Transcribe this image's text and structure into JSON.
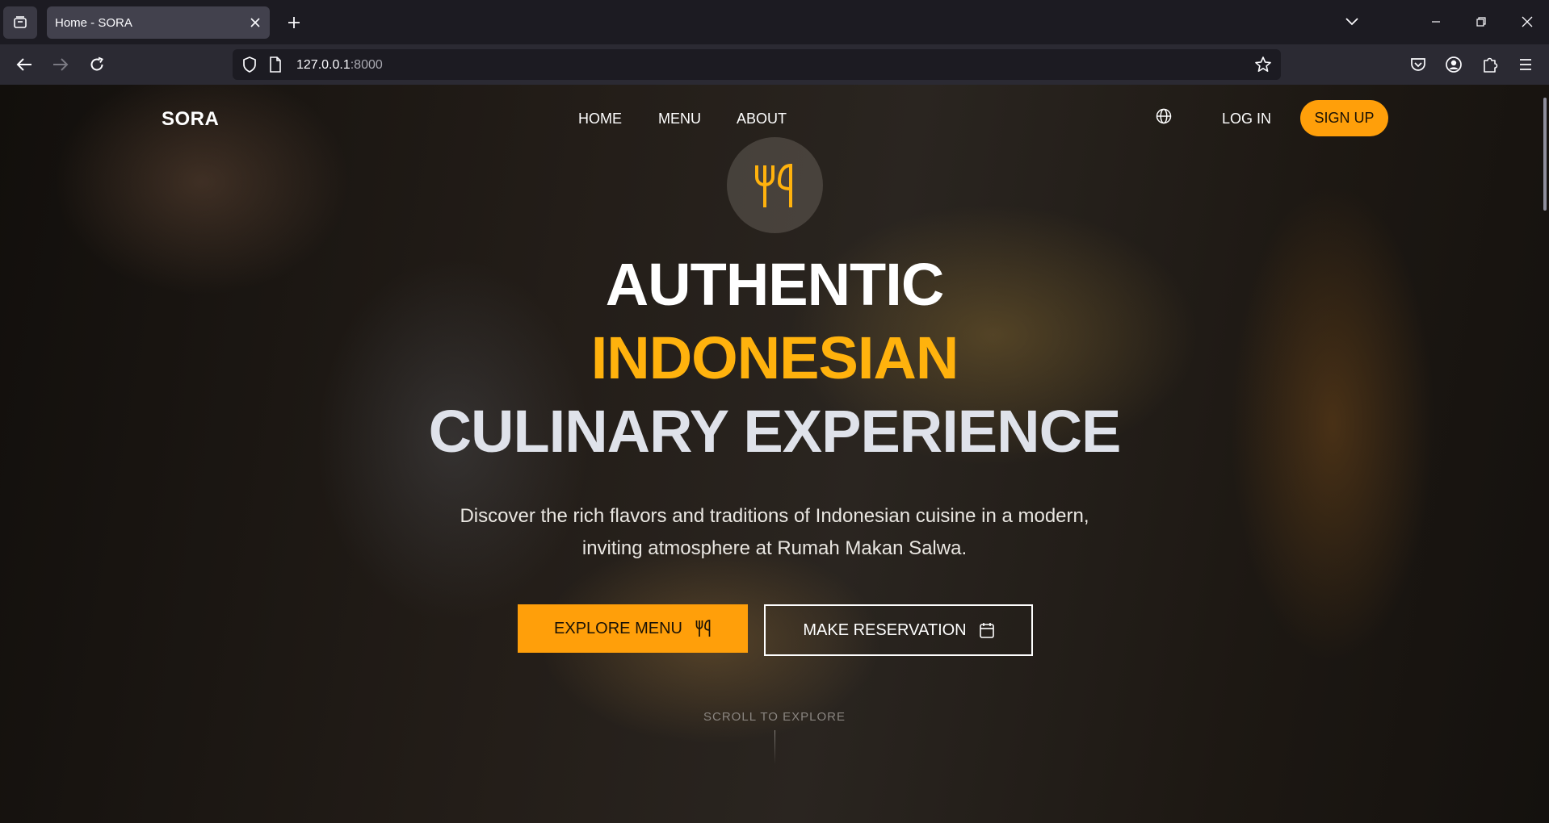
{
  "browser": {
    "tab_title": "Home - SORA",
    "url_host": "127.0.0.1",
    "url_port": ":8000",
    "icons": [
      "tab-list-icon",
      "close-icon",
      "plus-icon",
      "chevron-down-icon",
      "minimize-icon",
      "restore-icon",
      "close-window-icon",
      "back-arrow-icon",
      "forward-arrow-icon",
      "reload-icon",
      "shield-icon",
      "page-icon",
      "star-icon",
      "pocket-icon",
      "account-icon",
      "extensions-icon",
      "menu-icon"
    ]
  },
  "site": {
    "brand": "SORA",
    "nav": {
      "home": "HOME",
      "menu": "MENU",
      "about": "ABOUT"
    },
    "login": "LOG IN",
    "signup": "SIGN UP",
    "accent_color": "#ff9f0a"
  },
  "hero": {
    "line1": "AUTHENTIC",
    "line2": "INDONESIAN",
    "line3": "CULINARY EXPERIENCE",
    "subtitle_line1": "Discover the rich flavors and traditions of Indonesian cuisine in a modern,",
    "subtitle_line2": "inviting atmosphere at Rumah Makan Salwa.",
    "explore_button": "EXPLORE MENU",
    "reserve_button": "MAKE RESERVATION",
    "scroll_hint": "SCROLL TO EXPLORE"
  }
}
